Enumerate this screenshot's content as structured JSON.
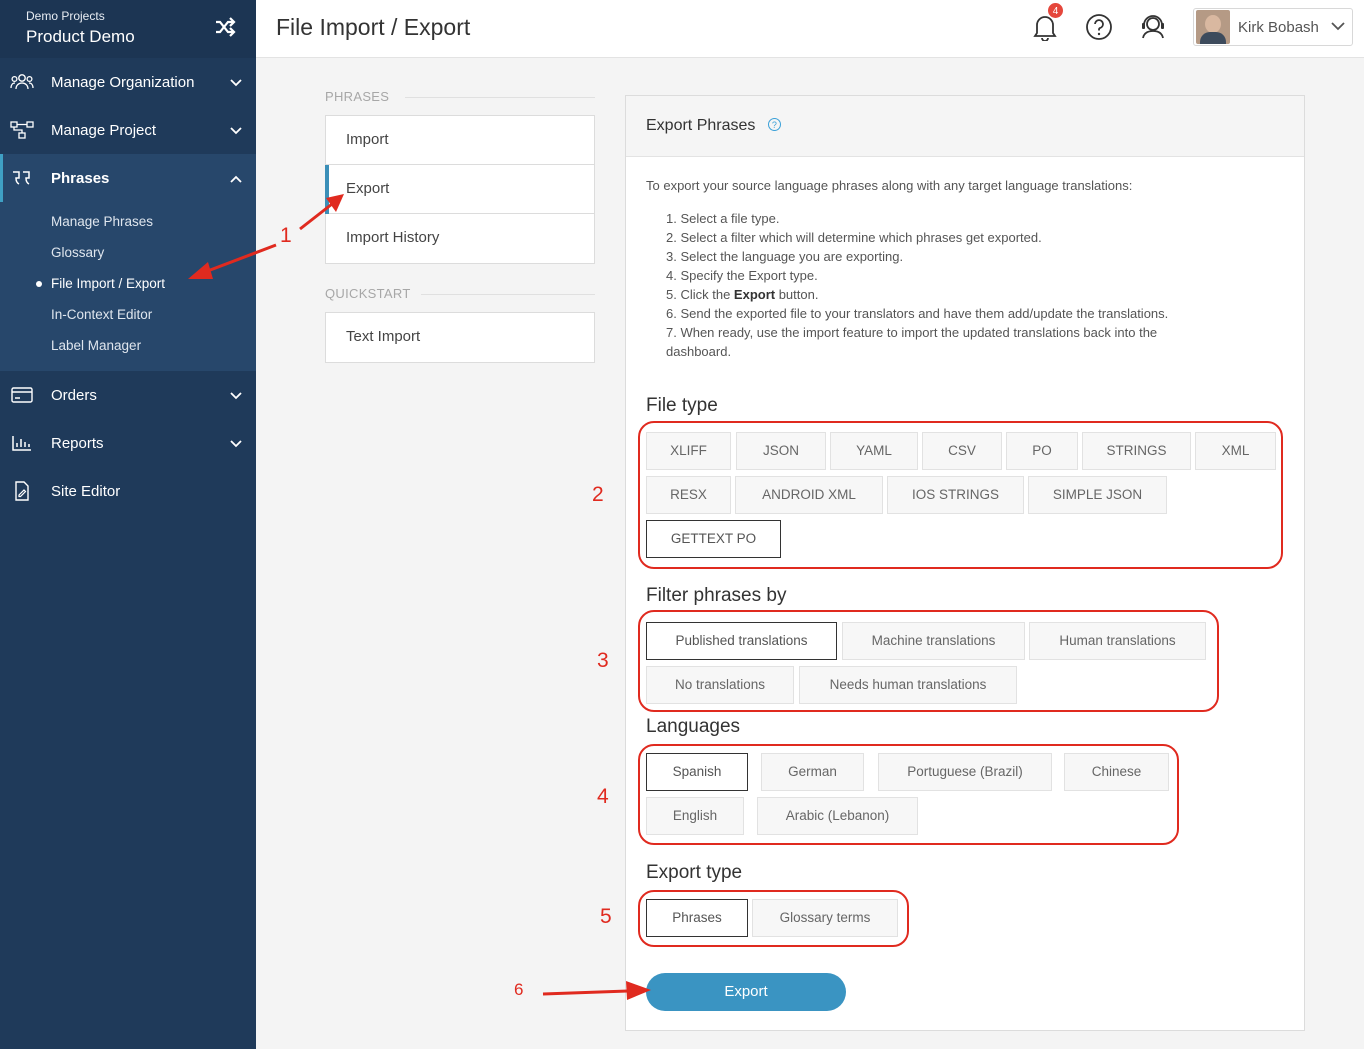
{
  "sidebar": {
    "org": "Demo Projects",
    "project": "Product Demo",
    "items": [
      {
        "label": "Manage Organization"
      },
      {
        "label": "Manage Project"
      },
      {
        "label": "Phrases"
      },
      {
        "label": "Orders"
      },
      {
        "label": "Reports"
      },
      {
        "label": "Site Editor"
      }
    ],
    "sub": [
      "Manage Phrases",
      "Glossary",
      "File Import / Export",
      "In-Context Editor",
      "Label Manager"
    ]
  },
  "header": {
    "title": "File Import / Export",
    "notification_count": "4",
    "user_name": "Kirk Bobash"
  },
  "tabs": {
    "phrases_label": "PHRASES",
    "phrases": [
      "Import",
      "Export",
      "Import History"
    ],
    "quickstart_label": "QUICKSTART",
    "quickstart": [
      "Text Import"
    ]
  },
  "panel": {
    "title": "Export Phrases",
    "intro": "To export your source language phrases along with any target language translations:",
    "steps": {
      "s1": "1. Select a file type.",
      "s2": "2. Select a filter which will determine which phrases get exported.",
      "s3": "3. Select the language you are exporting.",
      "s4": "4. Specify the Export type.",
      "s5a": "5. Click the ",
      "s5b": "Export",
      "s5c": " button.",
      "s6": "6. Send the exported file to your translators and have them add/update the translations.",
      "s7a": "7. When ready, use the import feature to import the updated translations back into the",
      "s7b": "dashboard."
    },
    "file_type_heading": "File type",
    "file_types": [
      "XLIFF",
      "JSON",
      "YAML",
      "CSV",
      "PO",
      "STRINGS",
      "XML",
      "RESX",
      "ANDROID XML",
      "IOS STRINGS",
      "SIMPLE JSON",
      "GETTEXT PO"
    ],
    "filter_heading": "Filter phrases by",
    "filters": [
      "Published translations",
      "Machine translations",
      "Human translations",
      "No translations",
      "Needs human translations"
    ],
    "languages_heading": "Languages",
    "languages": [
      "Spanish",
      "German",
      "Portuguese (Brazil)",
      "Chinese",
      "English",
      "Arabic (Lebanon)"
    ],
    "export_type_heading": "Export type",
    "export_types": [
      "Phrases",
      "Glossary terms"
    ],
    "export_button": "Export"
  },
  "annotations": [
    "1",
    "2",
    "3",
    "4",
    "5",
    "6"
  ],
  "colors": {
    "sidebar": "#1f3a5a",
    "accent": "#3a94c2",
    "annotation": "#e02a1f"
  }
}
